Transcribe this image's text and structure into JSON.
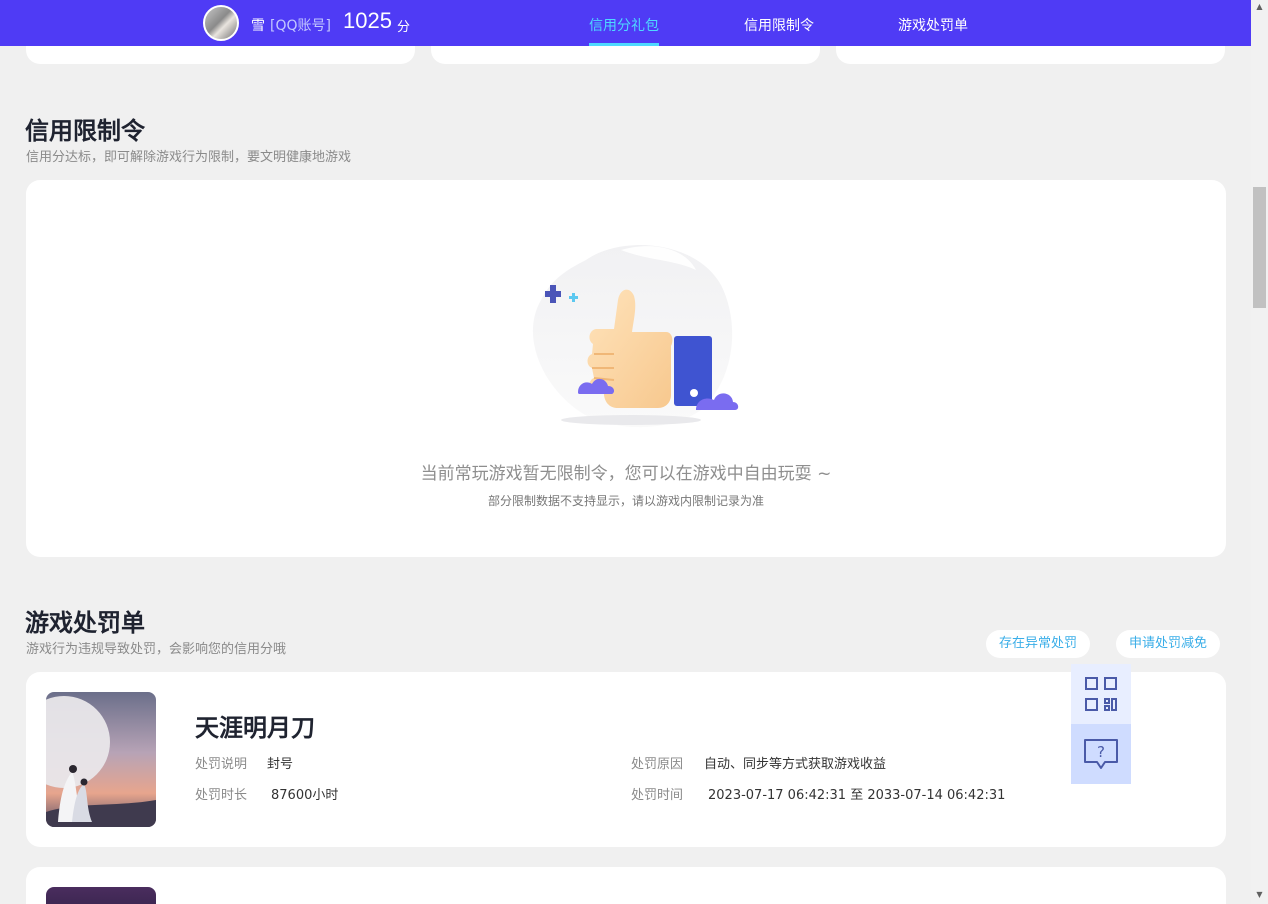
{
  "header": {
    "username": "雪",
    "account_type": "[QQ账号]",
    "score": "1025",
    "score_unit": "分",
    "tabs": [
      {
        "label": "信用分礼包",
        "active": true
      },
      {
        "label": "信用限制令",
        "active": false
      },
      {
        "label": "游戏处罚单",
        "active": false
      }
    ]
  },
  "restriction": {
    "title": "信用限制令",
    "subtitle": "信用分达标，即可解除游戏行为限制，要文明健康地游戏",
    "empty_message": "当前常玩游戏暂无限制令，您可以在游戏中自由玩耍 ~",
    "empty_note": "部分限制数据不支持显示，请以游戏内限制记录为准",
    "illustration_icon": "thumbs-up-icon"
  },
  "penalty": {
    "title": "游戏处罚单",
    "subtitle": "游戏行为违规导致处罚，会影响您的信用分哦",
    "actions": {
      "abnormal": "存在异常处罚",
      "appeal": "申请处罚减免"
    },
    "items": [
      {
        "game": "天涯明月刀",
        "desc_label": "处罚说明",
        "desc_value": "封号",
        "duration_label": "处罚时长",
        "duration_value": "87600小时",
        "reason_label": "处罚原因",
        "reason_value": "自动、同步等方式获取游戏收益",
        "time_label": "处罚时间",
        "time_value": "2023-07-17 06:42:31 至 2033-07-14 06:42:31"
      }
    ]
  },
  "float_tools": [
    "qr-code-icon",
    "help-chat-icon"
  ],
  "colors": {
    "header_bg": "#4f3bf5",
    "active_tab": "#4ed9ff",
    "page_bg": "#f0f0f0",
    "link": "#3aaee8"
  }
}
